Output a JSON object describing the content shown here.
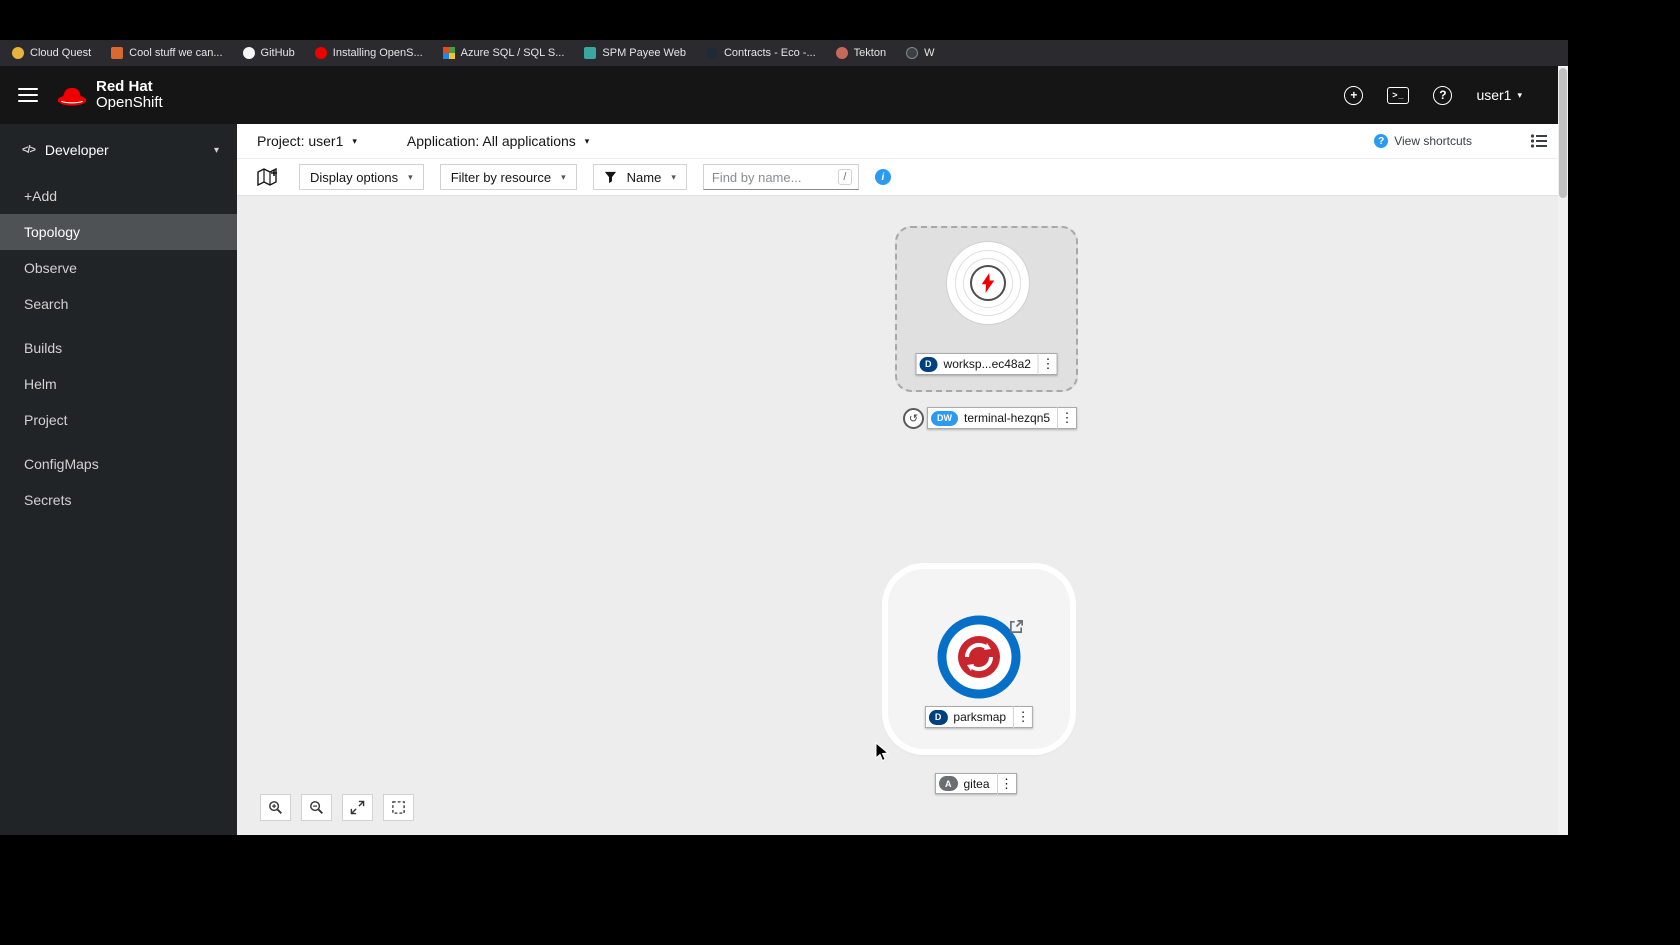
{
  "icons": {
    "caret": "▾",
    "kebab": "⋮",
    "code": "</>",
    "plus": "+",
    "question": "?",
    "terminal": ">_",
    "info": "i",
    "decorator_arrow": "↺",
    "bolt": "⚡"
  },
  "colors": {
    "masthead": "#151515",
    "sidebar": "#212427",
    "canvas": "#ededed",
    "accent_blue": "#2b9af3",
    "badge_deployment": "#004080",
    "badge_devworkspace": "#2b9af3",
    "badge_application": "#6a6e73",
    "redhat_red": "#ee0000",
    "parksmap_blue": "#0670c8",
    "parksmap_red": "#c9252d"
  },
  "bookmarks": {
    "items": [
      {
        "label": "Cloud Quest"
      },
      {
        "label": "Cool stuff we can..."
      },
      {
        "label": "GitHub"
      },
      {
        "label": "Installing OpenS..."
      },
      {
        "label": "Azure SQL / SQL S..."
      },
      {
        "label": "SPM Payee Web"
      },
      {
        "label": "Contracts - Eco -..."
      },
      {
        "label": "Tekton"
      },
      {
        "label": "W"
      }
    ]
  },
  "masthead": {
    "brand_top": "Red Hat",
    "brand_bottom": "OpenShift",
    "user": "user1"
  },
  "sidebar": {
    "perspective": "Developer",
    "groups": [
      {
        "items": [
          {
            "label": "+Add"
          },
          {
            "label": "Topology"
          },
          {
            "label": "Observe"
          },
          {
            "label": "Search"
          }
        ]
      },
      {
        "items": [
          {
            "label": "Builds"
          },
          {
            "label": "Helm"
          },
          {
            "label": "Project"
          }
        ]
      },
      {
        "items": [
          {
            "label": "ConfigMaps"
          },
          {
            "label": "Secrets"
          }
        ]
      }
    ]
  },
  "context_bar": {
    "project": "Project: user1",
    "application": "Application: All applications",
    "view_shortcuts": "View shortcuts"
  },
  "toolbar": {
    "display_options": "Display options",
    "filter_by_resource": "Filter by resource",
    "name": "Name",
    "find_placeholder": "Find by name...",
    "slash": "/"
  },
  "topology": {
    "workspace": {
      "badge": "D",
      "label": "worksp...ec48a2"
    },
    "terminal": {
      "badge": "DW",
      "label": "terminal-hezqn5"
    },
    "parksmap": {
      "badge": "D",
      "label": "parksmap"
    },
    "gitea": {
      "badge": "A",
      "label": "gitea"
    }
  }
}
